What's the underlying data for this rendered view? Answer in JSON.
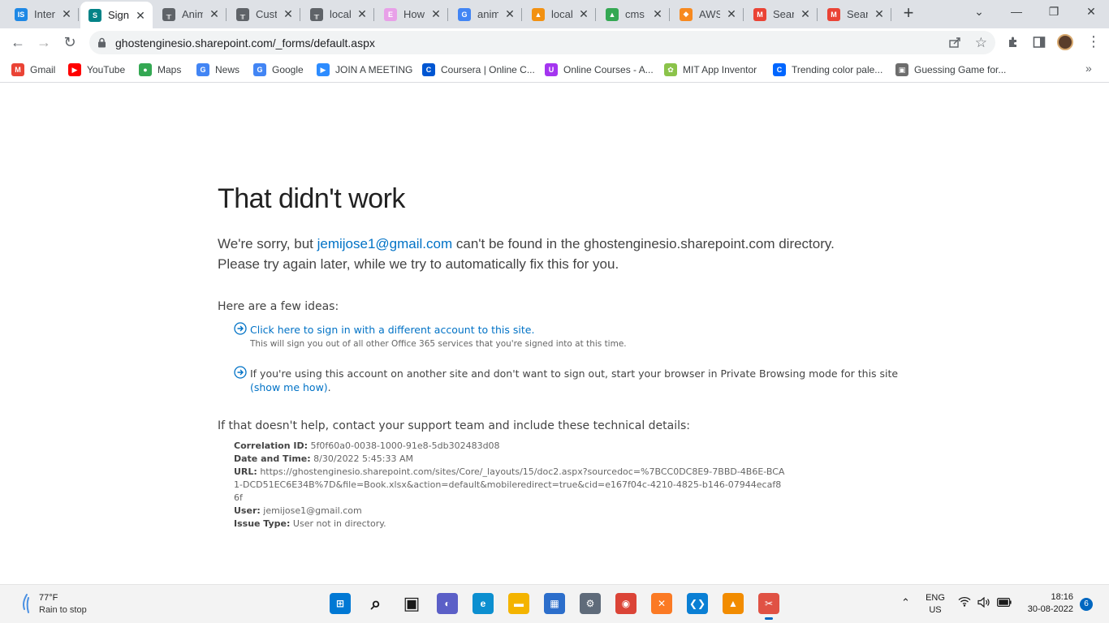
{
  "browser": {
    "tabs": [
      {
        "title": "Intern",
        "icon": "is-icon",
        "color": "#1e88e5",
        "glyph": "IS"
      },
      {
        "title": "Sign",
        "icon": "sharepoint-icon",
        "color": "#038387",
        "glyph": "S",
        "active": true
      },
      {
        "title": "Anim",
        "icon": "column-icon",
        "color": "#5f6368",
        "glyph": "╥"
      },
      {
        "title": "Custo",
        "icon": "column-icon",
        "color": "#5f6368",
        "glyph": "╥"
      },
      {
        "title": "localh",
        "icon": "column-icon",
        "color": "#5f6368",
        "glyph": "╥"
      },
      {
        "title": "How",
        "icon": "circle-e-icon",
        "color": "#e8a0e8",
        "glyph": "E"
      },
      {
        "title": "anim",
        "icon": "google-icon",
        "color": "#4285f4",
        "glyph": "G"
      },
      {
        "title": "localh",
        "icon": "phpmyadmin-icon",
        "color": "#f29111",
        "glyph": "▲"
      },
      {
        "title": "cms",
        "icon": "google-drive-icon",
        "color": "#34a853",
        "glyph": "▲"
      },
      {
        "title": "AWS",
        "icon": "aws-icon",
        "color": "#f7891f",
        "glyph": "◆"
      },
      {
        "title": "Searc",
        "icon": "gmail-icon",
        "color": "#ea4335",
        "glyph": "M"
      },
      {
        "title": "Searc",
        "icon": "gmail-icon",
        "color": "#ea4335",
        "glyph": "M"
      }
    ],
    "url": "ghostenginesio.sharepoint.com/_forms/default.aspx"
  },
  "bookmarks": [
    {
      "label": "Gmail",
      "icon": "gmail-icon",
      "color": "#ea4335",
      "glyph": "M"
    },
    {
      "label": "YouTube",
      "icon": "youtube-icon",
      "color": "#ff0000",
      "glyph": "▶"
    },
    {
      "label": "Maps",
      "icon": "maps-icon",
      "color": "#34a853",
      "glyph": "●"
    },
    {
      "label": "News",
      "icon": "news-icon",
      "color": "#4285f4",
      "glyph": "G"
    },
    {
      "label": "Google",
      "icon": "google-icon",
      "color": "#4285f4",
      "glyph": "G"
    },
    {
      "label": "JOIN A MEETING",
      "icon": "zoom-icon",
      "color": "#2d8cff",
      "glyph": "▶"
    },
    {
      "label": "Coursera | Online C...",
      "icon": "coursera-icon",
      "color": "#0056d2",
      "glyph": "C"
    },
    {
      "label": "Online Courses - A...",
      "icon": "udemy-icon",
      "color": "#a435f0",
      "glyph": "U"
    },
    {
      "label": "MIT App Inventor",
      "icon": "app-inventor-icon",
      "color": "#8bc34a",
      "glyph": "✿"
    },
    {
      "label": "Trending color pale...",
      "icon": "coolors-icon",
      "color": "#0066ff",
      "glyph": "C"
    },
    {
      "label": "Guessing Game for...",
      "icon": "game-icon",
      "color": "#6d6d6d",
      "glyph": "▣"
    }
  ],
  "content": {
    "heading": "That didn't work",
    "lead_prefix": "We're sorry, but ",
    "lead_email": "jemijose1@gmail.com",
    "lead_suffix": " can't be found in the ghostenginesio.sharepoint.com directory. Please try again later, while we try to automatically fix this for you.",
    "ideas_label": "Here are a few ideas:",
    "idea1_link": "Click here to sign in with a different account to this site.",
    "idea1_note": "This will sign you out of all other Office 365 services that you're signed into at this time.",
    "idea2_text": "If you're using this account on another site and don't want to sign out, start your browser in Private Browsing mode for this site ",
    "idea2_link": "(show me how)",
    "idea2_end": ".",
    "help_text": "If that doesn't help, contact your support team and include these technical details:",
    "details": {
      "correlation_label": "Correlation ID:",
      "correlation_value": "5f0f60a0-0038-1000-91e8-5db302483d08",
      "datetime_label": "Date and Time:",
      "datetime_value": "8/30/2022 5:45:33 AM",
      "url_label": "URL:",
      "url_value": "https://ghostenginesio.sharepoint.com/sites/Core/_layouts/15/doc2.aspx?sourcedoc=%7BCC0DC8E9-7BBD-4B6E-BCA1-DCD51EC6E34B%7D&file=Book.xlsx&action=default&mobileredirect=true&cid=e167f04c-4210-4825-b146-07944ecaf86f",
      "user_label": "User:",
      "user_value": "jemijose1@gmail.com",
      "issue_label": "Issue Type:",
      "issue_value": "User not in directory."
    }
  },
  "taskbar": {
    "weather_temp": "77°F",
    "weather_cond": "Rain to stop",
    "apps": [
      {
        "name": "windows-start-icon",
        "color": "#0078d4",
        "glyph": "⊞"
      },
      {
        "name": "search-icon",
        "color": "#1a1a1a",
        "glyph": "⌕"
      },
      {
        "name": "task-view-icon",
        "color": "#1a1a1a",
        "glyph": "▣"
      },
      {
        "name": "chat-icon",
        "color": "#5b5fc7",
        "glyph": "◐"
      },
      {
        "name": "edge-icon",
        "color": "#0c8fd0",
        "glyph": "e"
      },
      {
        "name": "file-explorer-icon",
        "color": "#f4b400",
        "glyph": "▬"
      },
      {
        "name": "store-icon",
        "color": "#2c6ecb",
        "glyph": "▦"
      },
      {
        "name": "settings-icon",
        "color": "#5f6b7a",
        "glyph": "⚙"
      },
      {
        "name": "chrome-icon",
        "color": "#db4437",
        "glyph": "◉"
      },
      {
        "name": "xampp-icon",
        "color": "#fb7a24",
        "glyph": "✕"
      },
      {
        "name": "vscode-icon",
        "color": "#0a7fd4",
        "glyph": "❮❯"
      },
      {
        "name": "vlc-icon",
        "color": "#f28c00",
        "glyph": "▲"
      },
      {
        "name": "snipping-tool-icon",
        "color": "#e05244",
        "glyph": "✂",
        "active": true
      }
    ],
    "lang": "ENG",
    "region": "US",
    "time": "18:16",
    "date": "30-08-2022",
    "notifications": "6"
  }
}
